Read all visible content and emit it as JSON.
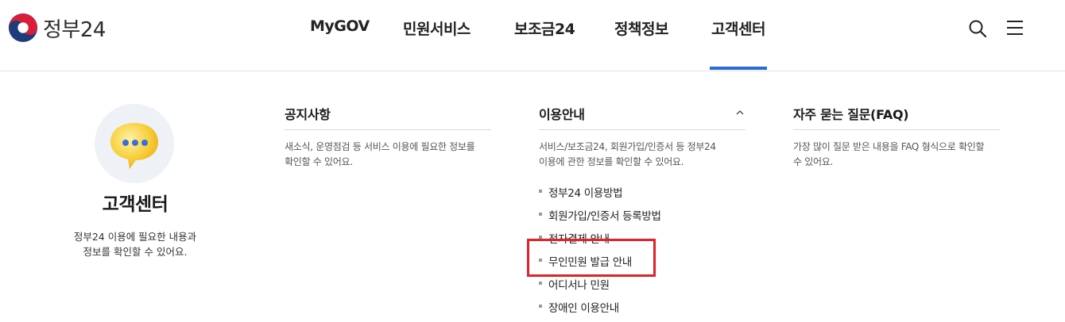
{
  "brand": {
    "logo_text": "정부24"
  },
  "nav": {
    "items": [
      "MyGOV",
      "민원서비스",
      "보조금24",
      "정책정보",
      "고객센터"
    ],
    "active": "고객센터"
  },
  "intro": {
    "title": "고객센터",
    "desc_line1": "정부24 이용에 필요한 내용과",
    "desc_line2": "정보를 확인할 수 있어요."
  },
  "columns": [
    {
      "title": "공지사항",
      "desc_line1": "새소식, 운영점검 등 서비스 이용에 필요한 정보를",
      "desc_line2": "확인할 수 있어요."
    },
    {
      "title": "이용안내",
      "desc_line1": "서비스/보조금24, 회원가입/인증서 등 정부24",
      "desc_line2": "이용에 관한 정보를 확인할 수 있어요.",
      "expanded": true,
      "items": [
        "정부24 이용방법",
        "회원가입/인증서 등록방법",
        "전자결제 안내",
        "무인민원 발급 안내",
        "어디서나 민원",
        "장애인 이용안내"
      ]
    },
    {
      "title": "자주 묻는 질문(FAQ)",
      "desc_line1": "가장 많이 질문 받은 내용을 FAQ 형식으로 확인할",
      "desc_line2": "수 있어요."
    }
  ],
  "colors": {
    "accent": "#2d6bd5",
    "highlight": "#e4232a"
  },
  "icons": {
    "search": "search-icon",
    "menu": "hamburger-menu-icon",
    "speech": "speech-bubble-icon"
  }
}
